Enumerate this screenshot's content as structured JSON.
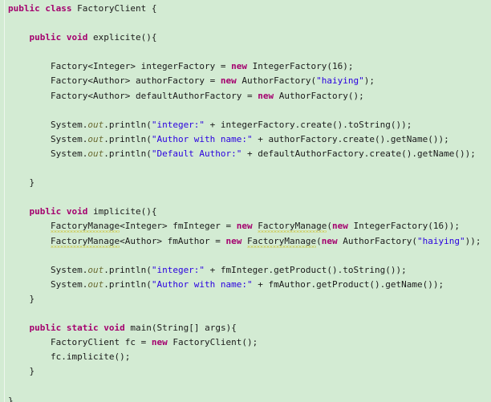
{
  "editor": {
    "language": "java",
    "background_color": "#d3ebd3",
    "keyword_color": "#a4006e",
    "string_color": "#2a00e0",
    "field_color": "#6a6a30",
    "text_color": "#1a1a1a",
    "warning_underline_color": "#c8b400",
    "class_name": "FactoryClient",
    "lines": [
      {
        "n": 1,
        "indent": 0,
        "tokens": [
          {
            "t": "kw",
            "v": "public"
          },
          {
            "t": "plain",
            "v": " "
          },
          {
            "t": "kw",
            "v": "class"
          },
          {
            "t": "plain",
            "v": " FactoryClient {"
          }
        ]
      },
      {
        "n": 2,
        "indent": 0,
        "tokens": []
      },
      {
        "n": 3,
        "indent": 1,
        "tokens": [
          {
            "t": "kw",
            "v": "public"
          },
          {
            "t": "plain",
            "v": " "
          },
          {
            "t": "kw",
            "v": "void"
          },
          {
            "t": "plain",
            "v": " explicite(){"
          }
        ]
      },
      {
        "n": 4,
        "indent": 0,
        "tokens": []
      },
      {
        "n": 5,
        "indent": 2,
        "tokens": [
          {
            "t": "plain",
            "v": "Factory<Integer> integerFactory = "
          },
          {
            "t": "kw",
            "v": "new"
          },
          {
            "t": "plain",
            "v": " IntegerFactory(16);"
          }
        ]
      },
      {
        "n": 6,
        "indent": 2,
        "tokens": [
          {
            "t": "plain",
            "v": "Factory<Author> authorFactory = "
          },
          {
            "t": "kw",
            "v": "new"
          },
          {
            "t": "plain",
            "v": " AuthorFactory("
          },
          {
            "t": "str",
            "v": "\"haiying\""
          },
          {
            "t": "plain",
            "v": ");"
          }
        ]
      },
      {
        "n": 7,
        "indent": 2,
        "tokens": [
          {
            "t": "plain",
            "v": "Factory<Author> defaultAuthorFactory = "
          },
          {
            "t": "kw",
            "v": "new"
          },
          {
            "t": "plain",
            "v": " AuthorFactory();"
          }
        ]
      },
      {
        "n": 8,
        "indent": 0,
        "tokens": []
      },
      {
        "n": 9,
        "indent": 2,
        "tokens": [
          {
            "t": "plain",
            "v": "System."
          },
          {
            "t": "fld",
            "v": "out"
          },
          {
            "t": "plain",
            "v": ".println("
          },
          {
            "t": "str",
            "v": "\"integer:\""
          },
          {
            "t": "plain",
            "v": " + integerFactory.create().toString());"
          }
        ]
      },
      {
        "n": 10,
        "indent": 2,
        "tokens": [
          {
            "t": "plain",
            "v": "System."
          },
          {
            "t": "fld",
            "v": "out"
          },
          {
            "t": "plain",
            "v": ".println("
          },
          {
            "t": "str",
            "v": "\"Author with name:\""
          },
          {
            "t": "plain",
            "v": " + authorFactory.create().getName());"
          }
        ]
      },
      {
        "n": 11,
        "indent": 2,
        "tokens": [
          {
            "t": "plain",
            "v": "System."
          },
          {
            "t": "fld",
            "v": "out"
          },
          {
            "t": "plain",
            "v": ".println("
          },
          {
            "t": "str",
            "v": "\"Default Author:\""
          },
          {
            "t": "plain",
            "v": " + defaultAuthorFactory.create().getName());"
          }
        ]
      },
      {
        "n": 12,
        "indent": 0,
        "tokens": []
      },
      {
        "n": 13,
        "indent": 1,
        "tokens": [
          {
            "t": "plain",
            "v": "}"
          }
        ]
      },
      {
        "n": 14,
        "indent": 0,
        "tokens": []
      },
      {
        "n": 15,
        "indent": 1,
        "tokens": [
          {
            "t": "kw",
            "v": "public"
          },
          {
            "t": "plain",
            "v": " "
          },
          {
            "t": "kw",
            "v": "void"
          },
          {
            "t": "plain",
            "v": " implicite(){"
          }
        ]
      },
      {
        "n": 16,
        "indent": 2,
        "tokens": [
          {
            "t": "warn",
            "v": "FactoryManage"
          },
          {
            "t": "plain",
            "v": "<Integer> fmInteger = "
          },
          {
            "t": "kw",
            "v": "new"
          },
          {
            "t": "plain",
            "v": " "
          },
          {
            "t": "warn",
            "v": "FactoryManage"
          },
          {
            "t": "plain",
            "v": "("
          },
          {
            "t": "kw",
            "v": "new"
          },
          {
            "t": "plain",
            "v": " IntegerFactory(16));"
          }
        ]
      },
      {
        "n": 17,
        "indent": 2,
        "tokens": [
          {
            "t": "warn",
            "v": "FactoryManage"
          },
          {
            "t": "plain",
            "v": "<Author> fmAuthor = "
          },
          {
            "t": "kw",
            "v": "new"
          },
          {
            "t": "plain",
            "v": " "
          },
          {
            "t": "warn",
            "v": "FactoryManage"
          },
          {
            "t": "plain",
            "v": "("
          },
          {
            "t": "kw",
            "v": "new"
          },
          {
            "t": "plain",
            "v": " AuthorFactory("
          },
          {
            "t": "str",
            "v": "\"haiying\""
          },
          {
            "t": "plain",
            "v": "));"
          }
        ]
      },
      {
        "n": 18,
        "indent": 0,
        "tokens": []
      },
      {
        "n": 19,
        "indent": 2,
        "tokens": [
          {
            "t": "plain",
            "v": "System."
          },
          {
            "t": "fld",
            "v": "out"
          },
          {
            "t": "plain",
            "v": ".println("
          },
          {
            "t": "str",
            "v": "\"integer:\""
          },
          {
            "t": "plain",
            "v": " + fmInteger.getProduct().toString());"
          }
        ]
      },
      {
        "n": 20,
        "indent": 2,
        "tokens": [
          {
            "t": "plain",
            "v": "System."
          },
          {
            "t": "fld",
            "v": "out"
          },
          {
            "t": "plain",
            "v": ".println("
          },
          {
            "t": "str",
            "v": "\"Author with name:\""
          },
          {
            "t": "plain",
            "v": " + fmAuthor.getProduct().getName());"
          }
        ]
      },
      {
        "n": 21,
        "indent": 1,
        "tokens": [
          {
            "t": "plain",
            "v": "}"
          }
        ]
      },
      {
        "n": 22,
        "indent": 0,
        "tokens": []
      },
      {
        "n": 23,
        "indent": 1,
        "tokens": [
          {
            "t": "kw",
            "v": "public"
          },
          {
            "t": "plain",
            "v": " "
          },
          {
            "t": "kw",
            "v": "static"
          },
          {
            "t": "plain",
            "v": " "
          },
          {
            "t": "kw",
            "v": "void"
          },
          {
            "t": "plain",
            "v": " main(String[] args){"
          }
        ]
      },
      {
        "n": 24,
        "indent": 2,
        "tokens": [
          {
            "t": "plain",
            "v": "FactoryClient fc = "
          },
          {
            "t": "kw",
            "v": "new"
          },
          {
            "t": "plain",
            "v": " FactoryClient();"
          }
        ]
      },
      {
        "n": 25,
        "indent": 2,
        "tokens": [
          {
            "t": "plain",
            "v": "fc.implicite();"
          }
        ]
      },
      {
        "n": 26,
        "indent": 1,
        "tokens": [
          {
            "t": "plain",
            "v": "}"
          }
        ]
      },
      {
        "n": 27,
        "indent": 0,
        "tokens": []
      },
      {
        "n": 28,
        "indent": 0,
        "tokens": [
          {
            "t": "plain",
            "v": "}"
          }
        ]
      }
    ]
  }
}
